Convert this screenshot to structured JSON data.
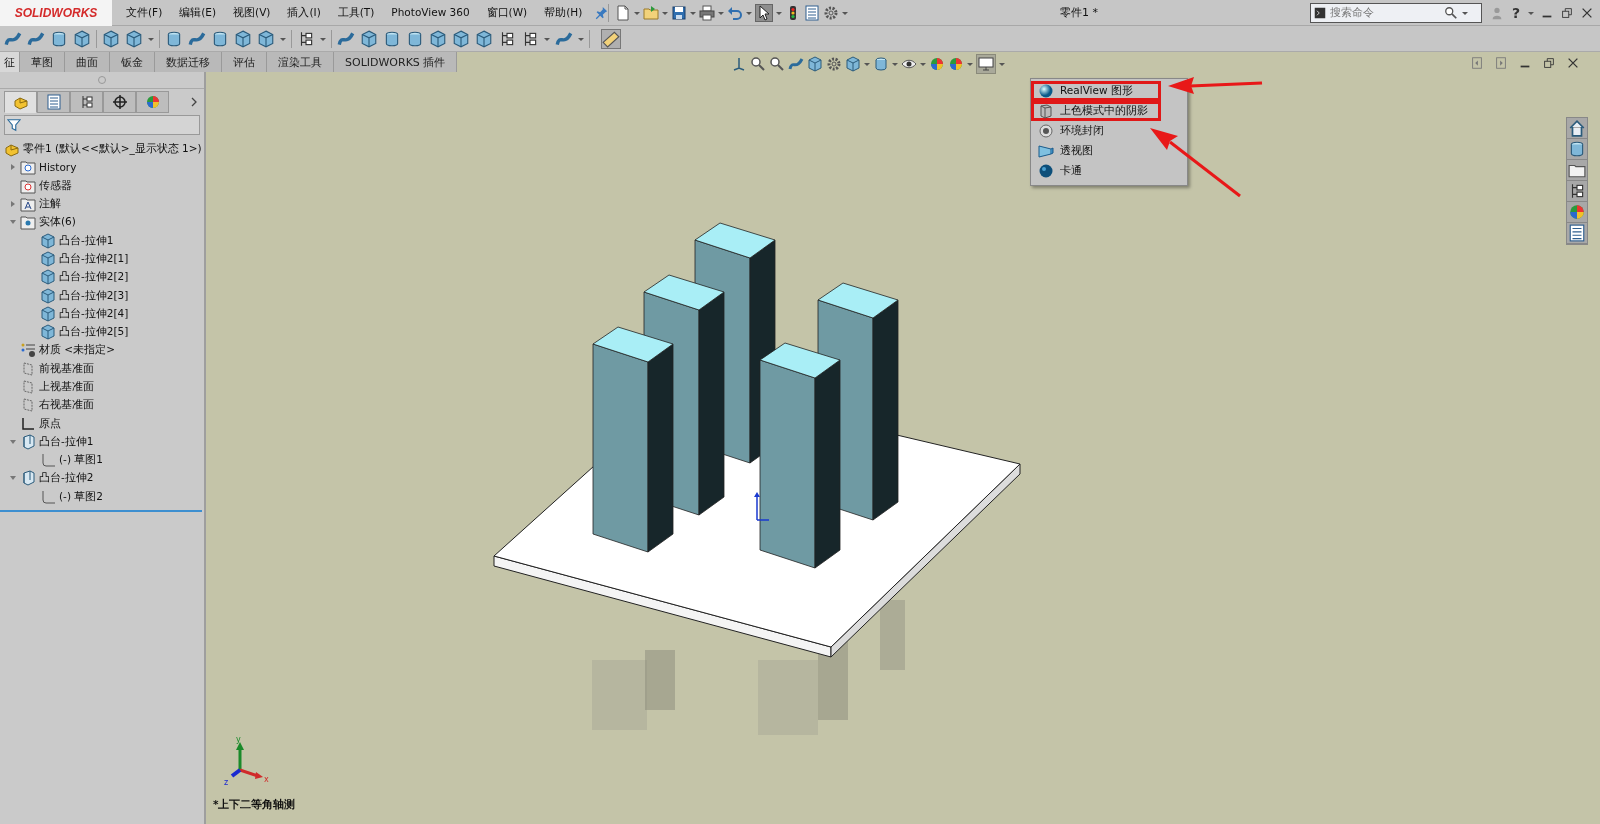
{
  "app": {
    "logo": "SOLIDWORKS"
  },
  "menu_bar": [
    "文件(F)",
    "编辑(E)",
    "视图(V)",
    "插入(I)",
    "工具(T)",
    "PhotoView 360",
    "窗口(W)",
    "帮助(H)"
  ],
  "window": {
    "title": "零件1 *"
  },
  "search": {
    "placeholder": "搜索命令"
  },
  "help": "?",
  "command_tabs": [
    {
      "label": "征",
      "selected": true
    },
    {
      "label": "草图",
      "selected": false
    },
    {
      "label": "曲面",
      "selected": false
    },
    {
      "label": "钣金",
      "selected": false
    },
    {
      "label": "数据迁移",
      "selected": false
    },
    {
      "label": "评估",
      "selected": false
    },
    {
      "label": "渲染工具",
      "selected": false
    },
    {
      "label": "SOLIDWORKS 插件",
      "selected": false
    }
  ],
  "panel_tabs": [
    {
      "kind": "feature",
      "selected": true
    },
    {
      "kind": "property",
      "selected": false
    },
    {
      "kind": "configuration",
      "selected": false
    },
    {
      "kind": "dimxpert",
      "selected": false
    },
    {
      "kind": "display",
      "selected": false
    }
  ],
  "feature_tree": {
    "root": "零件1  (默认<<默认>_显示状态 1>)",
    "items": [
      {
        "kind": "history",
        "label": "History",
        "expanded": false
      },
      {
        "kind": "sensor",
        "label": "传感器"
      },
      {
        "kind": "annotation",
        "label": "注解",
        "expanded": false
      },
      {
        "kind": "bodies",
        "label": "实体(6)",
        "expanded": true,
        "children": [
          {
            "kind": "body",
            "label": "凸台-拉伸1"
          },
          {
            "kind": "body",
            "label": "凸台-拉伸2[1]"
          },
          {
            "kind": "body",
            "label": "凸台-拉伸2[2]"
          },
          {
            "kind": "body",
            "label": "凸台-拉伸2[3]"
          },
          {
            "kind": "body",
            "label": "凸台-拉伸2[4]"
          },
          {
            "kind": "body",
            "label": "凸台-拉伸2[5]"
          }
        ]
      },
      {
        "kind": "material",
        "label": "材质 <未指定>"
      },
      {
        "kind": "plane",
        "label": "前视基准面"
      },
      {
        "kind": "plane",
        "label": "上视基准面"
      },
      {
        "kind": "plane",
        "label": "右视基准面"
      },
      {
        "kind": "origin",
        "label": "原点"
      },
      {
        "kind": "extrude",
        "label": "凸台-拉伸1",
        "expanded": true,
        "children": [
          {
            "kind": "sketch",
            "label": "(-) 草图1"
          }
        ]
      },
      {
        "kind": "extrude",
        "label": "凸台-拉伸2",
        "expanded": true,
        "children": [
          {
            "kind": "sketch",
            "label": "(-) 草图2"
          }
        ]
      }
    ]
  },
  "display_menu": {
    "items": [
      {
        "kind": "realview",
        "label": "RealView 图形",
        "highlighted": true
      },
      {
        "kind": "shadows",
        "label": "上色模式中的阴影",
        "highlighted": true
      },
      {
        "kind": "occlusion",
        "label": "环境封闭",
        "highlighted": false
      },
      {
        "kind": "perspective",
        "label": "透视图",
        "highlighted": false
      },
      {
        "kind": "cartoon",
        "label": "卡通",
        "highlighted": false
      }
    ]
  },
  "triad": {
    "x": "x",
    "y": "y",
    "z": "z"
  },
  "view_label": "*上下二等角轴测"
}
